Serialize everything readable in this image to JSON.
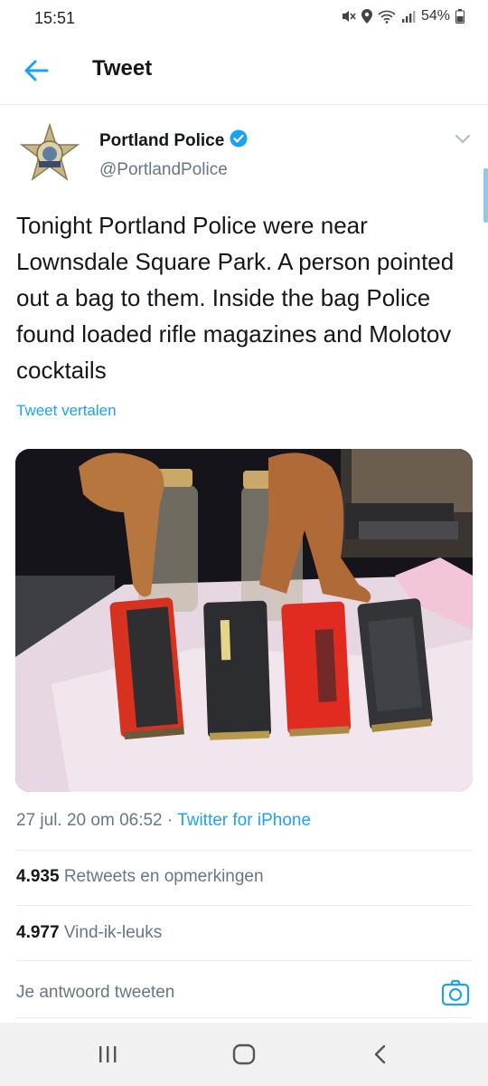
{
  "status_bar": {
    "time": "15:51",
    "battery_percent": "54%",
    "icons": [
      "mute-icon",
      "location-icon",
      "wifi-icon",
      "signal-icon",
      "battery-icon"
    ]
  },
  "header": {
    "title": "Tweet",
    "back_icon": "arrow-left-icon"
  },
  "tweet": {
    "author": {
      "name": "Portland Police",
      "handle": "@PortlandPolice",
      "verified": true,
      "avatar_icon": "police-star-badge"
    },
    "text": "Tonight Portland Police were near Lownsdale Square Park. A person pointed out a bag to them. Inside the bag Police found loaded rifle magazines and Molotov cocktails",
    "translate_label": "Tweet vertalen",
    "media_description": "photo",
    "timestamp": "27 jul. 20 om 06:52",
    "separator": "·",
    "source": "Twitter for iPhone",
    "stats": {
      "retweets_count": "4.935",
      "retweets_label": "Retweets en opmerkingen",
      "likes_count": "4.977",
      "likes_label": "Vind-ik-leuks"
    },
    "reply_placeholder": "Je antwoord tweeten"
  },
  "colors": {
    "accent": "#1da1f2",
    "text_primary": "#14171a",
    "text_secondary": "#657786",
    "divider": "#e6ecf0",
    "nav_bar": "#f1f1f1"
  },
  "nav_bar": {
    "icons": [
      "recent-apps-icon",
      "home-icon",
      "back-icon"
    ]
  }
}
